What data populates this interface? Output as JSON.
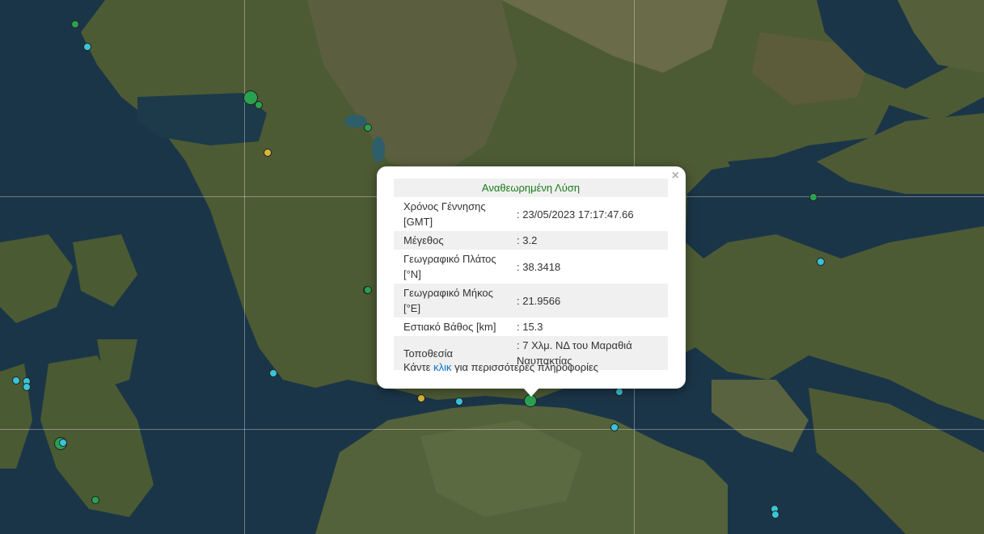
{
  "map": {
    "colors": {
      "sea": "#1a3347",
      "land": "#4b5a33",
      "selected_marker": "#2aa152"
    },
    "markers": [
      {
        "color": "#2aa152",
        "size": "small"
      },
      {
        "color": "#38c4d8",
        "size": "small"
      },
      {
        "color": "#2aa152",
        "size": "large"
      },
      {
        "color": "#2aa152",
        "size": "small"
      },
      {
        "color": "#d9b53a",
        "size": "small"
      },
      {
        "color": "#2aa152",
        "size": "small"
      },
      {
        "color": "#2aa152",
        "size": "small"
      },
      {
        "color": "#38c4d8",
        "size": "small"
      },
      {
        "color": "#2aa152",
        "size": "small"
      },
      {
        "color": "#2aa152",
        "size": "small"
      },
      {
        "color": "#38c4d8",
        "size": "small"
      },
      {
        "color": "#38c4d8",
        "size": "small"
      },
      {
        "color": "#38c4d8",
        "size": "small"
      },
      {
        "color": "#2aa152",
        "size": "medium"
      },
      {
        "color": "#38c4d8",
        "size": "small"
      },
      {
        "color": "#2aa152",
        "size": "small"
      },
      {
        "color": "#d9b53a",
        "size": "small"
      },
      {
        "color": "#38c4d8",
        "size": "small"
      },
      {
        "color": "#2aa152",
        "size": "medium",
        "selected": true
      },
      {
        "color": "#38c4d8",
        "size": "small"
      },
      {
        "color": "#38c4d8",
        "size": "small"
      },
      {
        "color": "#38c4d8",
        "size": "small"
      },
      {
        "color": "#38c4d8",
        "size": "small"
      },
      {
        "color": "#38c4d8",
        "size": "small"
      }
    ]
  },
  "popup": {
    "title": "Αναθεωρημένη Λύση",
    "close_label": "×",
    "rows": [
      {
        "label": "Χρόνος Γέννησης [GMT]",
        "value": ": 23/05/2023 17:17:47.66"
      },
      {
        "label": "Μέγεθος",
        "value": ": 3.2"
      },
      {
        "label": "Γεωγραφικό Πλάτος [°N]",
        "value": ": 38.3418"
      },
      {
        "label": "Γεωγραφικό Μήκος [°E]",
        "value": ": 21.9566"
      },
      {
        "label": "Εστιακό Βάθος [km]",
        "value": ": 15.3"
      },
      {
        "label": "Τοποθεσία",
        "value": ": 7 Χλμ. ΝΔ του Μαραθιά Ναυπακτίας"
      }
    ],
    "more_prefix": "Κάντε ",
    "more_link": "κλικ",
    "more_suffix": " για περισσότερες πληροφορίες"
  }
}
